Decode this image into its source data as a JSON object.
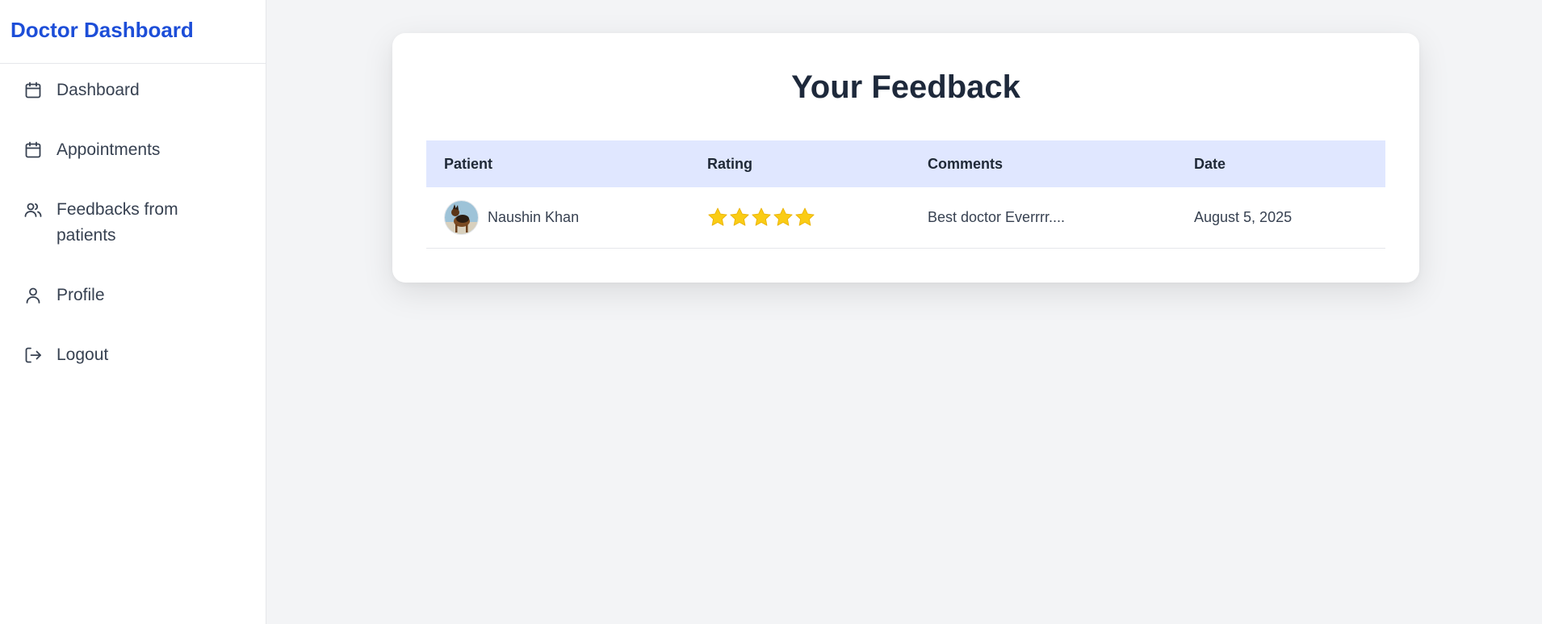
{
  "sidebar": {
    "brand": "Doctor Dashboard",
    "items": [
      {
        "label": "Dashboard",
        "icon": "calendar-icon"
      },
      {
        "label": "Appointments",
        "icon": "calendar-icon"
      },
      {
        "label": "Feedbacks from patients",
        "icon": "users-icon"
      },
      {
        "label": "Profile",
        "icon": "user-icon"
      },
      {
        "label": "Logout",
        "icon": "logout-icon"
      }
    ]
  },
  "main": {
    "title": "Your Feedback",
    "table": {
      "headers": {
        "patient": "Patient",
        "rating": "Rating",
        "comments": "Comments",
        "date": "Date"
      },
      "rows": [
        {
          "patient": "Naushin Khan",
          "rating": 5,
          "comments": "Best doctor Everrrr....",
          "date": "August 5, 2025"
        }
      ]
    }
  },
  "colors": {
    "brand": "#1d4ed8",
    "table_header_bg": "#e0e7ff",
    "star": "#facc15",
    "background": "#f3f4f6"
  }
}
